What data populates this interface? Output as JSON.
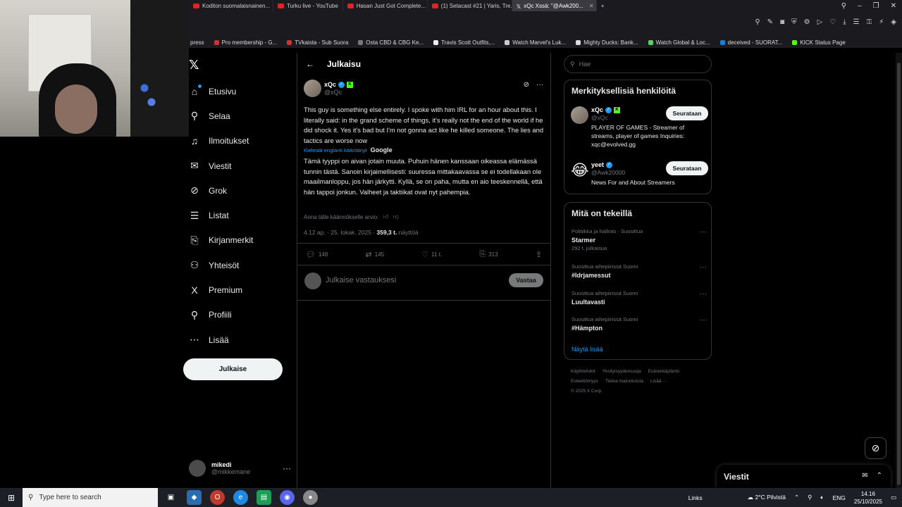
{
  "browser": {
    "tabs": [
      {
        "label": "Koditon suomalaisnainen...",
        "icon": "youtube-icon"
      },
      {
        "label": "Turku live - YouTube",
        "icon": "youtube-icon"
      },
      {
        "label": "Hasan Just Got Complete...",
        "icon": "youtube-icon"
      },
      {
        "label": "(1) Setacast #21 | Yaris, Tre...",
        "icon": "youtube-icon"
      },
      {
        "label": "xQc Xssä: \"@Awk200...",
        "icon": "x-icon",
        "active": true
      }
    ],
    "new_tab": "+",
    "bookmarks": [
      "press",
      "Pro membership - G...",
      "TVkaista - Sub Suora",
      "Osta CBD & CBG Ke...",
      "Travis Scott Outfits,...",
      "Watch Marvel's Luk...",
      "Mighty Ducks: Bank...",
      "Watch Global & Loc...",
      "deceived - SUORAT...",
      "KICK Status Page"
    ]
  },
  "nav": {
    "items": [
      {
        "label": "Etusivu",
        "icon": "home-icon",
        "glyph": "⌂"
      },
      {
        "label": "Selaa",
        "icon": "search-icon",
        "glyph": "⚲"
      },
      {
        "label": "Ilmoitukset",
        "icon": "bell-icon",
        "glyph": "♫"
      },
      {
        "label": "Viestit",
        "icon": "mail-icon",
        "glyph": "✉"
      },
      {
        "label": "Grok",
        "icon": "grok-icon",
        "glyph": "⊘"
      },
      {
        "label": "Listat",
        "icon": "list-icon",
        "glyph": "☰"
      },
      {
        "label": "Kirjanmerkit",
        "icon": "bookmark-icon",
        "glyph": "⎘"
      },
      {
        "label": "Yhteisöt",
        "icon": "communities-icon",
        "glyph": "⚇"
      },
      {
        "label": "Premium",
        "icon": "x-premium-icon",
        "glyph": "X"
      },
      {
        "label": "Profiili",
        "icon": "profile-icon",
        "glyph": "⚲"
      },
      {
        "label": "Lisää",
        "icon": "more-circle-icon",
        "glyph": "⋯"
      }
    ],
    "post_button": "Julkaise",
    "account": {
      "name": "mikedi",
      "handle": "@mikkemane",
      "more": "···"
    }
  },
  "post": {
    "header_title": "Julkaisu",
    "author": {
      "name": "xQc",
      "handle": "@xQc"
    },
    "text": "This guy is something else entirely. I spoke with him IRL for an hour about this. I literally said: in the grand scheme of things, it's really not the end of the world if he did shock it. Yes it's bad but I'm not gonna act like he killed someone. The lies and tactics are worse now",
    "translated_from": "Kielestä englanti kääntänyt",
    "translator": "Google",
    "translation": "Tämä tyyppi on aivan jotain muuta. Puhuin hänen kanssaan oikeassa elämässä tunnin tästä. Sanoin kirjaimellisesti: suuressa mittakaavassa se ei todellakaan ole maailmanloppu, jos hän järkytti. Kyllä, se on paha, mutta en aio teeskennellä, että hän tappoi jonkun. Valheet ja taktiikat ovat nyt pahempia.",
    "rate_prompt": "Anna tälle käännökselle arvio:",
    "timestamp": "4.12 ap. · 25. lokak. 2025 · ",
    "views_count": "359,3 t.",
    "views_label": " näyttöä",
    "stats": {
      "replies": "148",
      "reposts": "145",
      "likes": "11 t.",
      "bookmarks": "313"
    },
    "reply_placeholder": "Julkaise vastauksesi",
    "reply_button": "Vastaa"
  },
  "right": {
    "search_placeholder": "Hae",
    "who_title": "Merkityksellisiä henkilöitä",
    "who": [
      {
        "name": "xQc",
        "handle": "@xQc",
        "bio": "PLAYER OF GAMES - Streamer of streams, player of games Inquiries: xqc@evolved.gg",
        "button": "Seurataan"
      },
      {
        "name": "yeet",
        "handle": "@Awk20000",
        "bio": "News For and About Streamers",
        "button": "Seurataan"
      }
    ],
    "trends_title": "Mitä on tekeillä",
    "trends": [
      {
        "category": "Politiikka ja hallinto · Suosittua",
        "name": "Starmer",
        "count": "292 t. julkaisua"
      },
      {
        "category": "Suosittua aihepiirissä Suomi",
        "name": "#Idrjamessut",
        "count": ""
      },
      {
        "category": "Suosittua aihepiirissä Suomi",
        "name": "Luultavasti",
        "count": ""
      },
      {
        "category": "Suosittua aihepiirissä Suomi",
        "name": "#Hämpton",
        "count": ""
      }
    ],
    "show_more": "Näytä lisää",
    "footer": [
      "Käyttöehdot",
      "Yksityisyydensuoja",
      "Evästekäytäntö",
      "Esteettömyys",
      "Tietoa mainoksista",
      "Lisää ···",
      "© 2025 X Corp."
    ]
  },
  "messages": {
    "title": "Viestit"
  },
  "taskbar": {
    "search_placeholder": "Type here to search",
    "links": "Links",
    "weather": "2°C Pilvistä",
    "lang": "ENG",
    "time": "14.16",
    "date": "25/10/2025"
  }
}
